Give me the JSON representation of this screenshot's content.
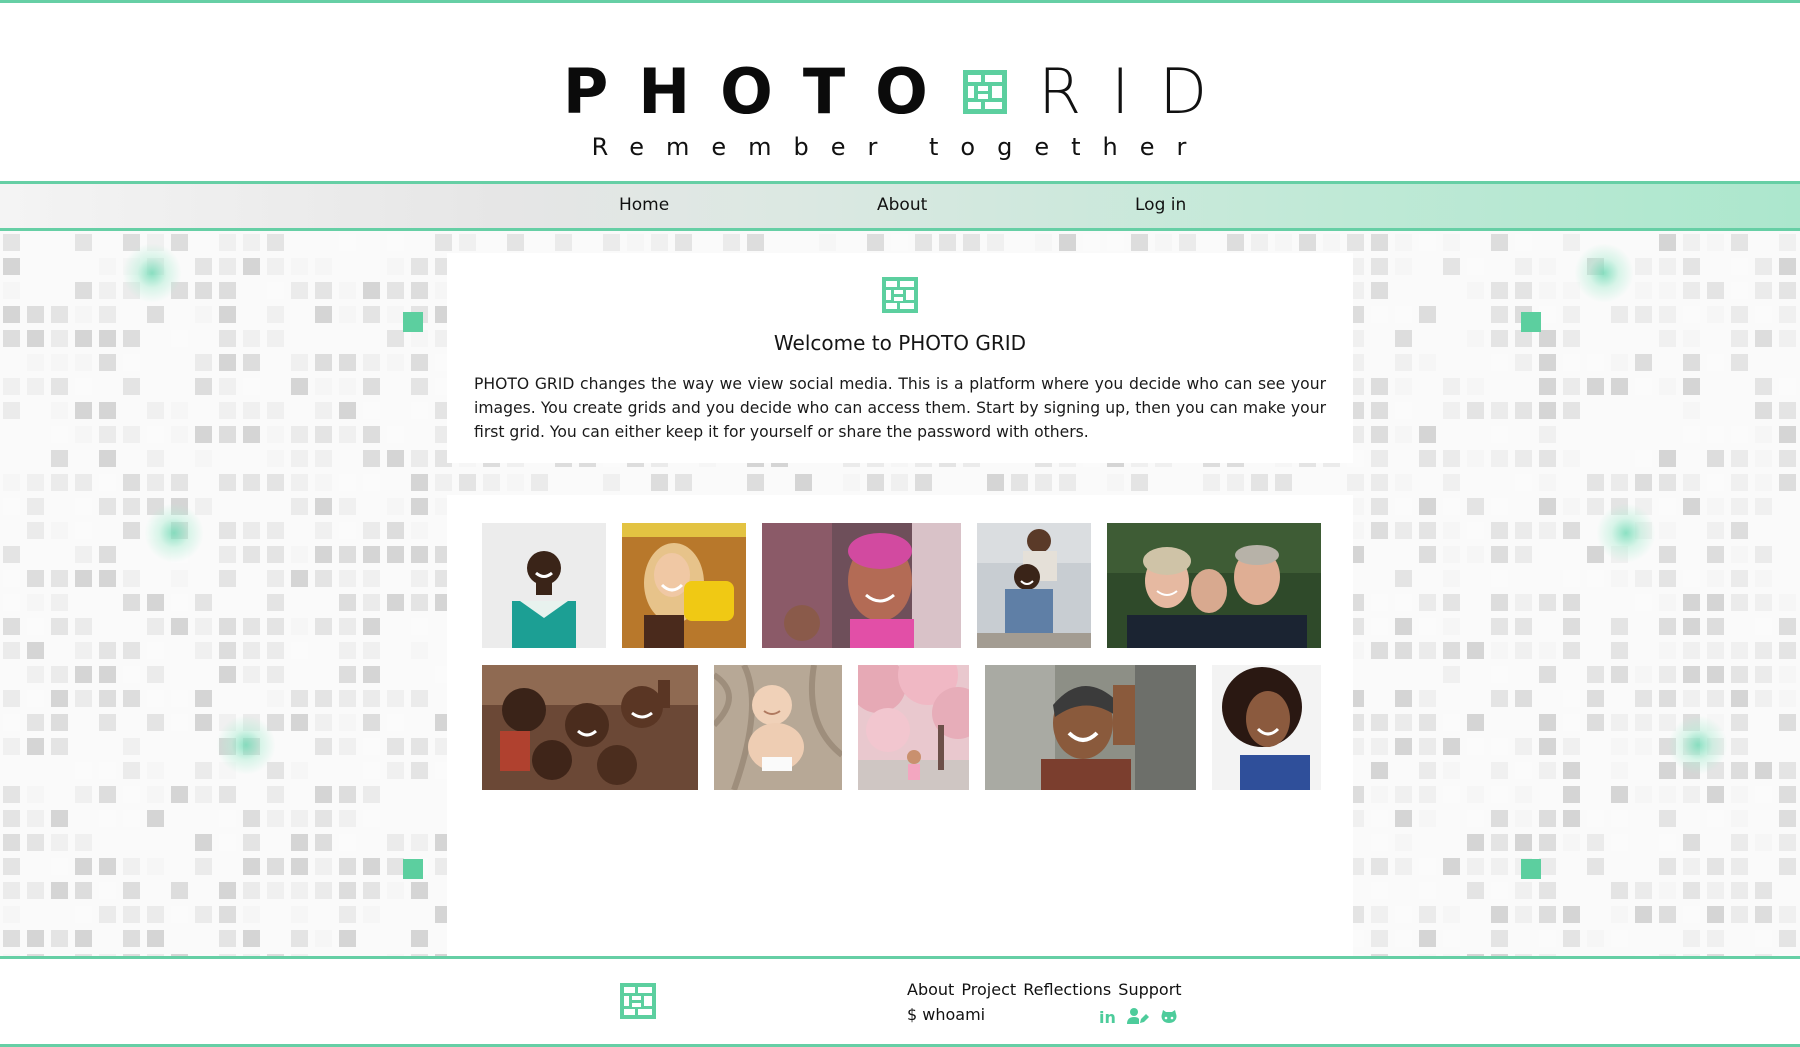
{
  "brand": {
    "logo_word_1": "PHOTO",
    "logo_word_2": "RID",
    "tagline": "Remember together",
    "accent_color": "#66cfa5"
  },
  "nav": {
    "items": [
      {
        "label": "Home"
      },
      {
        "label": "About"
      },
      {
        "label": "Log in"
      }
    ]
  },
  "welcome": {
    "icon": "grid-logo-icon",
    "title": "Welcome to PHOTO GRID",
    "body": "PHOTO GRID changes the way we view social media. This is a platform where you decide who can see your images. You create grids and you decide who can access them. Start by signing up, then you can make your first grid. You can either keep it for yourself or share the password with others."
  },
  "gallery": {
    "photos": [
      {
        "name": "photo-smiling-man-jersey"
      },
      {
        "name": "photo-woman-yellow-phone"
      },
      {
        "name": "photo-girl-pink-powder"
      },
      {
        "name": "photo-two-men-chairs"
      },
      {
        "name": "photo-family-group"
      },
      {
        "name": "photo-children-peace-signs"
      },
      {
        "name": "photo-baby-blanket"
      },
      {
        "name": "photo-cherry-blossom-child"
      },
      {
        "name": "photo-laughing-woman-street"
      },
      {
        "name": "photo-smiling-woman-curls"
      }
    ]
  },
  "footer": {
    "links": [
      {
        "label": "About"
      },
      {
        "label": "Project"
      },
      {
        "label": "Reflections"
      },
      {
        "label": "Support"
      }
    ],
    "whoami": "$ whoami",
    "social": [
      {
        "icon": "linkedin-icon",
        "label": "in"
      },
      {
        "icon": "user-edit-icon"
      },
      {
        "icon": "github-icon"
      }
    ]
  }
}
